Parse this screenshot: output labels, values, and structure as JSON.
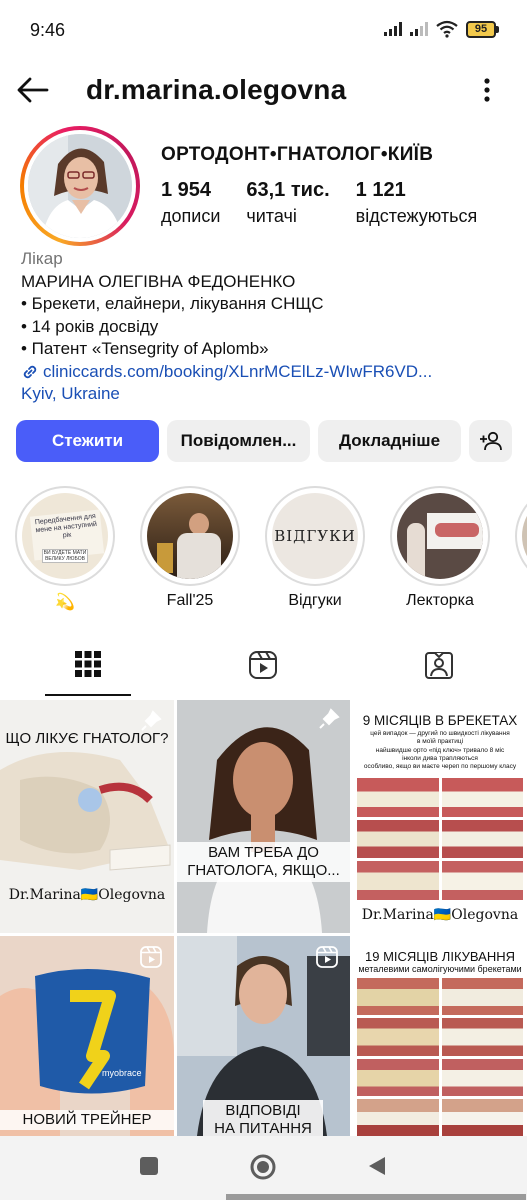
{
  "status": {
    "time": "9:46",
    "battery": "95"
  },
  "topbar": {
    "username": "dr.marina.olegovna"
  },
  "profile": {
    "category": "ОРТОДОНТ•ГНАТОЛОГ•КИЇВ",
    "stats": [
      {
        "value": "1 954",
        "label": "дописи"
      },
      {
        "value": "63,1 тис.",
        "label": "читачі"
      },
      {
        "value": "1 121",
        "label": "відстежуються"
      }
    ]
  },
  "bio": {
    "role": "Лікар",
    "lines": [
      "МАРИНА ОЛЕГІВНА ФЕДОНЕНКО",
      "• Брекети, елайнери, лікування СНЩС",
      "• 14 років досвіду",
      "• Патент «Tensegrity of Aplomb»"
    ],
    "link": "cliniccards.com/booking/XLnrMCElLz-WIwFR6VD...",
    "location": "Kyiv, Ukraine"
  },
  "actions": {
    "follow": "Стежити",
    "message": "Повідомлен...",
    "more": "Докладніше"
  },
  "highlights": [
    {
      "label": "💫",
      "card_text_1": "Передбачення для мене на наступний рік",
      "card_text_2": "ВИ БУДЕТЕ МАТИ ВЕЛИКУ ЛЮБОВ"
    },
    {
      "label": "Fall'25"
    },
    {
      "label": "Відгуки",
      "card_text": "ВІДГУКИ"
    },
    {
      "label": "Лекторка"
    }
  ],
  "posts": [
    {
      "caption": "ЩО ЛІКУЄ ГНАТОЛОГ?",
      "footer": "Dr.Marina🇺🇦Olegovna"
    },
    {
      "caption": "ВАМ ТРЕБА ДО ГНАТОЛОГА, ЯКЩО..."
    },
    {
      "title": "9 МІСЯЦІВ В БРЕКЕТАХ",
      "lines": [
        "цей випадок — другий по швидкості лікування",
        "в моїй практиці",
        "найшвидше орто «під ключ» тривало 8 міс",
        "інколи дива трапляються",
        "особливо, якщо ви маєте череп по першому класу"
      ],
      "footer": "Dr.Marina🇺🇦Olegovna"
    },
    {
      "caption": "НОВИЙ ТРЕЙНЕР",
      "product": "myobrace"
    },
    {
      "caption_1": "ВІДПОВІДІ",
      "caption_2": "НА ПИТАННЯ"
    },
    {
      "title": "19 МІСЯЦІВ ЛІКУВАННЯ",
      "subtitle": "металевими самолігуючими брекетами"
    }
  ]
}
